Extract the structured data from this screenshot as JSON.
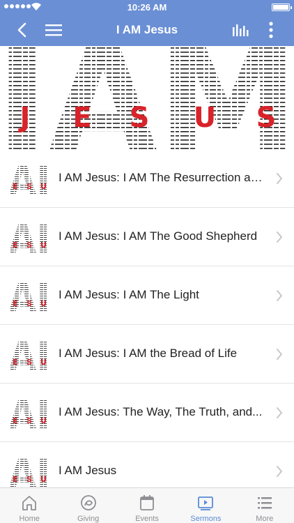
{
  "status_bar": {
    "time": "10:26 AM"
  },
  "nav": {
    "title": "I AM Jesus"
  },
  "banner": {
    "big_letters": "IAM",
    "red_letters": [
      "J",
      "E",
      "S",
      "U",
      "S"
    ]
  },
  "sermons": [
    {
      "title": "I AM Jesus: I AM The Resurrection an..."
    },
    {
      "title": "I AM Jesus: I AM The Good Shepherd"
    },
    {
      "title": "I AM Jesus: I AM The Light"
    },
    {
      "title": "I AM Jesus: I AM the Bread of Life"
    },
    {
      "title": "I AM Jesus: The Way, The Truth, and..."
    },
    {
      "title": "I AM Jesus"
    }
  ],
  "thumbnail": {
    "letters": "AI",
    "red_letters": [
      "E",
      "S",
      "U"
    ]
  },
  "tabs": [
    {
      "label": "Home",
      "icon": "home-icon"
    },
    {
      "label": "Giving",
      "icon": "giving-icon"
    },
    {
      "label": "Events",
      "icon": "calendar-icon"
    },
    {
      "label": "Sermons",
      "icon": "sermons-icon",
      "active": true
    },
    {
      "label": "More",
      "icon": "more-list-icon"
    }
  ],
  "colors": {
    "accent": "#6a8fd4",
    "active_tab": "#5a8ad6",
    "banner_red": "#d8232a"
  }
}
